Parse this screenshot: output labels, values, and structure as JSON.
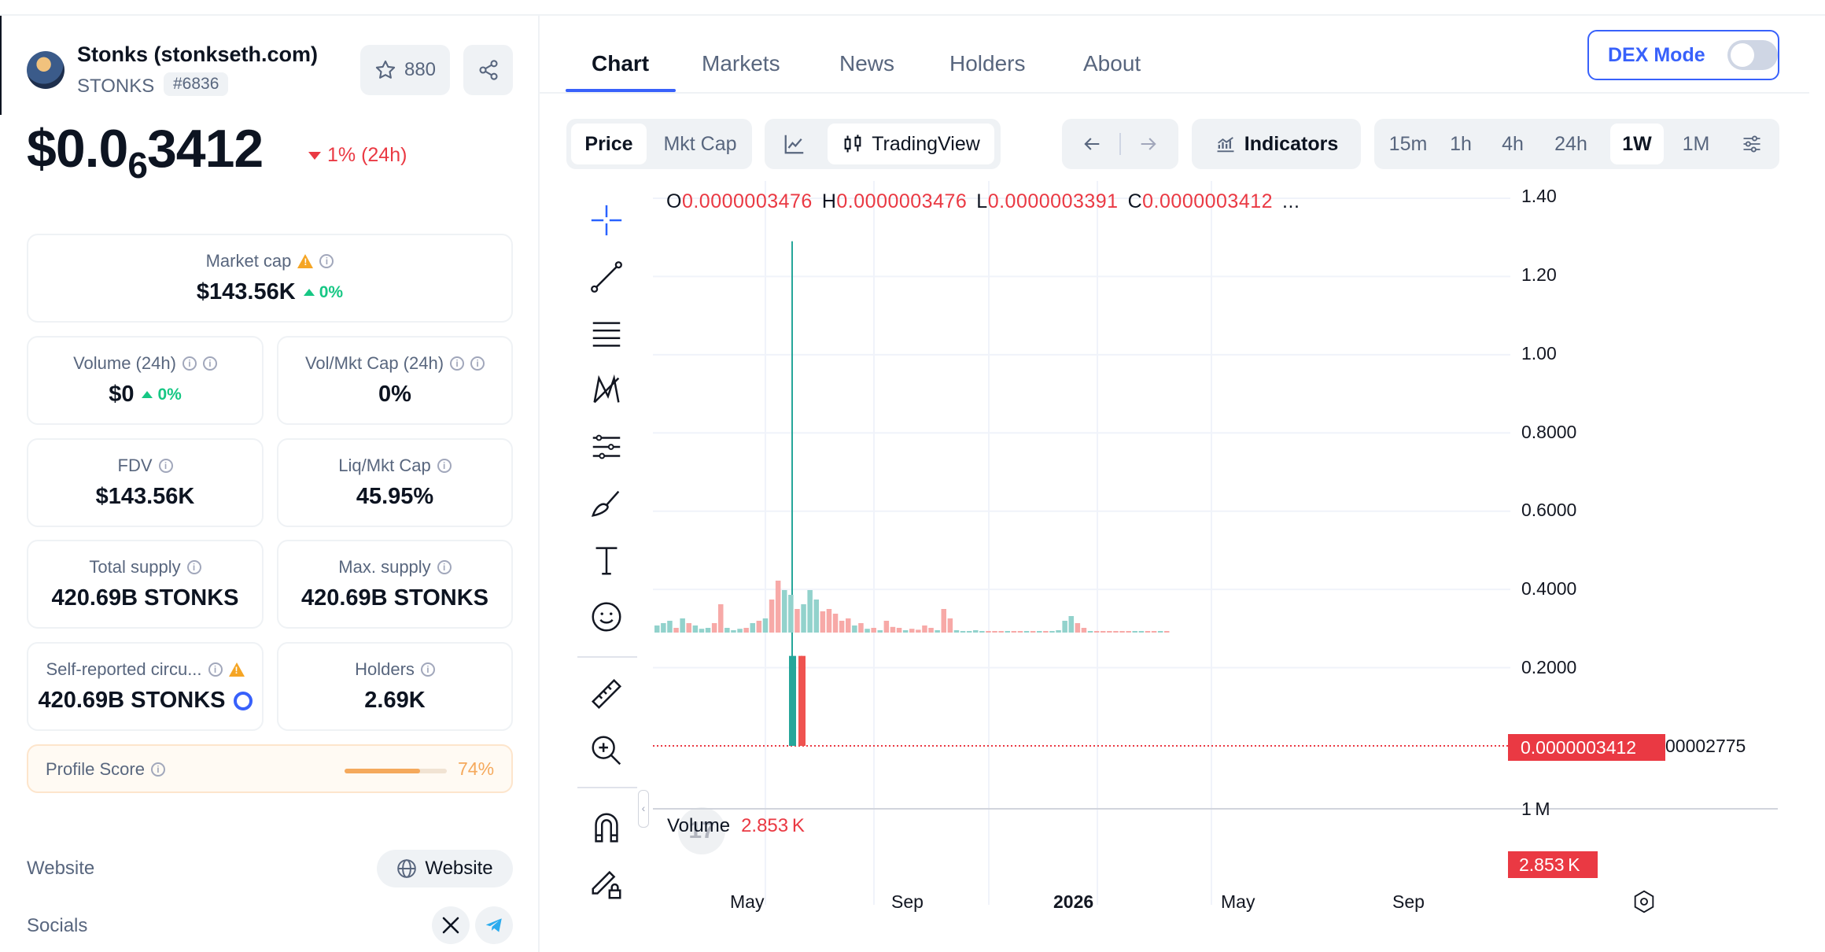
{
  "coin": {
    "name": "Stonks (stonkseth.com)",
    "symbol": "STONKS",
    "rank": "#6836",
    "watchlist_count": "880",
    "price_prefix": "$0.0",
    "price_sub": "6",
    "price_suffix": "3412",
    "change_24h": "1% (24h)"
  },
  "stats": {
    "market_cap": {
      "label": "Market cap",
      "value": "$143.56K",
      "change": "0%"
    },
    "volume": {
      "label": "Volume (24h)",
      "value": "$0",
      "change": "0%"
    },
    "vol_mkt_cap": {
      "label": "Vol/Mkt Cap (24h)",
      "value": "0%"
    },
    "fdv": {
      "label": "FDV",
      "value": "$143.56K"
    },
    "liq_mkt_cap": {
      "label": "Liq/Mkt Cap",
      "value": "45.95%"
    },
    "total_supply": {
      "label": "Total supply",
      "value": "420.69B STONKS"
    },
    "max_supply": {
      "label": "Max. supply",
      "value": "420.69B STONKS"
    },
    "circulating": {
      "label": "Self-reported circu...",
      "value": "420.69B STONKS"
    },
    "holders": {
      "label": "Holders",
      "value": "2.69K"
    }
  },
  "profile_score": {
    "label": "Profile Score",
    "value": "74%",
    "fraction": 0.74
  },
  "links": {
    "website_label": "Website",
    "website_button": "Website",
    "socials_label": "Socials"
  },
  "tabs": [
    "Chart",
    "Markets",
    "News",
    "Holders",
    "About"
  ],
  "dex_mode": {
    "label": "DEX Mode",
    "enabled": false
  },
  "toolbar": {
    "price": "Price",
    "mkt_cap": "Mkt Cap",
    "tradingview": "TradingView",
    "indicators": "Indicators",
    "intervals": [
      "15m",
      "1h",
      "4h",
      "24h",
      "1W",
      "1M"
    ],
    "active_interval": "1W"
  },
  "chart": {
    "ohlc": {
      "o_key": "O",
      "o": "0.0000003476",
      "h_key": "H",
      "h": "0.0000003476",
      "l_key": "L",
      "l": "0.0000003391",
      "c_key": "C",
      "c": "0.0000003412",
      "more": "..."
    },
    "price_tag": "0.0000003412",
    "price_tail": "00002775",
    "volume_label": "Volume",
    "volume_value": "2.853 K",
    "volume_tag": "2.853 K",
    "volume_axis": "1 M",
    "watermark": "17"
  },
  "chart_data": {
    "type": "bar",
    "y_ticks": [
      "1.40",
      "1.20",
      "1.00",
      "0.8000",
      "0.6000",
      "0.4000",
      "0.2000"
    ],
    "x_ticks": [
      "May",
      "Sep",
      "2026",
      "May",
      "Sep"
    ],
    "candles": [
      {
        "open": 0.23,
        "high": 1.29,
        "low": 0.0,
        "close": 0.0,
        "direction": "up"
      },
      {
        "open": 0.23,
        "high": 0.23,
        "low": 0.0,
        "close": 0.0,
        "direction": "down"
      }
    ],
    "volume_bars": [
      0.15,
      0.2,
      0.25,
      0.1,
      0.3,
      0.2,
      0.15,
      0.08,
      0.1,
      0.2,
      0.6,
      0.1,
      0.05,
      0.08,
      0.1,
      0.2,
      0.25,
      0.3,
      0.7,
      1.1,
      0.9,
      0.8,
      0.5,
      0.6,
      0.9,
      0.7,
      0.45,
      0.5,
      0.4,
      0.25,
      0.3,
      0.15,
      0.2,
      0.08,
      0.1,
      0.05,
      0.25,
      0.12,
      0.1,
      0.05,
      0.08,
      0.06,
      0.15,
      0.1,
      0.05,
      0.5,
      0.3,
      0.05,
      0.02,
      0.02,
      0.05,
      0.02,
      0.02,
      0.02,
      0.02,
      0.02,
      0.02,
      0.02,
      0.02,
      0.02,
      0.02,
      0.02,
      0.03,
      0.05,
      0.25,
      0.35,
      0.2,
      0.1,
      0.02,
      0.02,
      0.02,
      0.02,
      0.02,
      0.02,
      0.02,
      0.02,
      0.02,
      0.02,
      0.02,
      0.02,
      0.02
    ],
    "volume_colors": [
      "up",
      "up",
      "up",
      "down",
      "up",
      "down",
      "up",
      "up",
      "up",
      "down",
      "down",
      "up",
      "up",
      "up",
      "down",
      "up",
      "down",
      "up",
      "down",
      "down",
      "up",
      "up",
      "down",
      "up",
      "up",
      "up",
      "down",
      "down",
      "down",
      "down",
      "down",
      "up",
      "down",
      "up",
      "down",
      "up",
      "down",
      "down",
      "down",
      "up",
      "down",
      "down",
      "down",
      "down",
      "up",
      "down",
      "down",
      "up",
      "up",
      "up",
      "up",
      "up",
      "down",
      "down",
      "down",
      "up",
      "down",
      "down",
      "up",
      "down",
      "up",
      "down",
      "up",
      "up",
      "up",
      "up",
      "down",
      "down",
      "up",
      "down",
      "down",
      "down",
      "down",
      "down",
      "down",
      "up",
      "up",
      "down",
      "down",
      "up",
      "down"
    ]
  },
  "colors": {
    "up": "#26a69a",
    "down": "#ef5350",
    "accent": "#3861fb",
    "negative": "#ea3943",
    "positive": "#16c784"
  }
}
